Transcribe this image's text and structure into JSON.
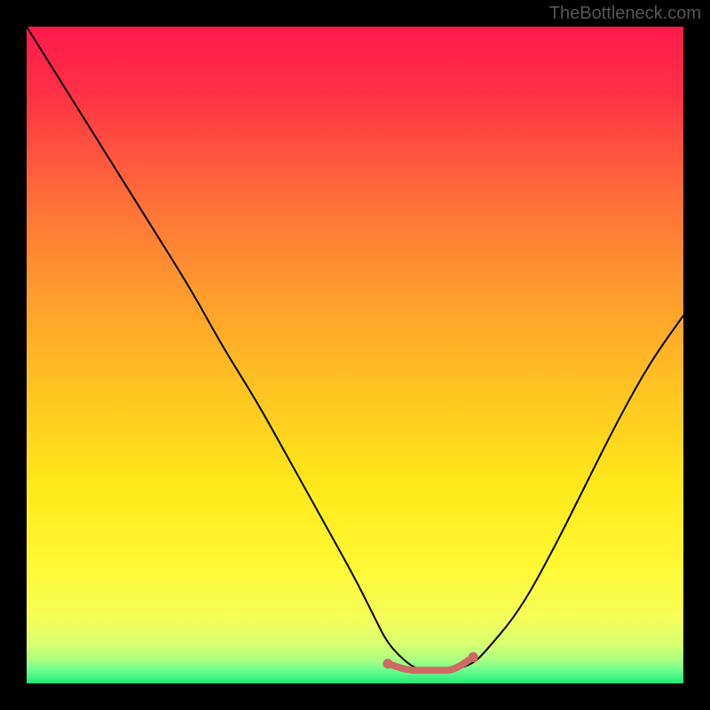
{
  "watermark": "TheBottleneck.com",
  "chart_data": {
    "type": "line",
    "title": "",
    "xlabel": "",
    "ylabel": "",
    "xlim": [
      0,
      100
    ],
    "ylim": [
      0,
      100
    ],
    "background_gradient_stops": [
      {
        "pos": 0,
        "color": "#ff1a4b"
      },
      {
        "pos": 25,
        "color": "#ff6a3a"
      },
      {
        "pos": 55,
        "color": "#ffc322"
      },
      {
        "pos": 82,
        "color": "#fff833"
      },
      {
        "pos": 96,
        "color": "#a8ff82"
      },
      {
        "pos": 100,
        "color": "#22e87a"
      }
    ],
    "series": [
      {
        "name": "bottleneck-curve",
        "color": "#000000",
        "width": 2,
        "x": [
          0,
          5,
          10,
          15,
          20,
          25,
          30,
          35,
          40,
          45,
          50,
          53,
          55,
          58,
          60,
          63,
          65,
          68,
          70,
          75,
          80,
          85,
          90,
          95,
          100
        ],
        "y": [
          100,
          92,
          84,
          76,
          68,
          60,
          51,
          43,
          34,
          25,
          16,
          10,
          6,
          3,
          2,
          2,
          2,
          3,
          5,
          11,
          20,
          30,
          40,
          49,
          56
        ]
      },
      {
        "name": "optimal-range-marker",
        "color": "#cf6a63",
        "width": 8,
        "marker_ends": true,
        "x": [
          55,
          58,
          60,
          63,
          65,
          68
        ],
        "y": [
          3,
          2,
          2,
          2,
          2,
          4
        ]
      }
    ],
    "annotations": []
  }
}
